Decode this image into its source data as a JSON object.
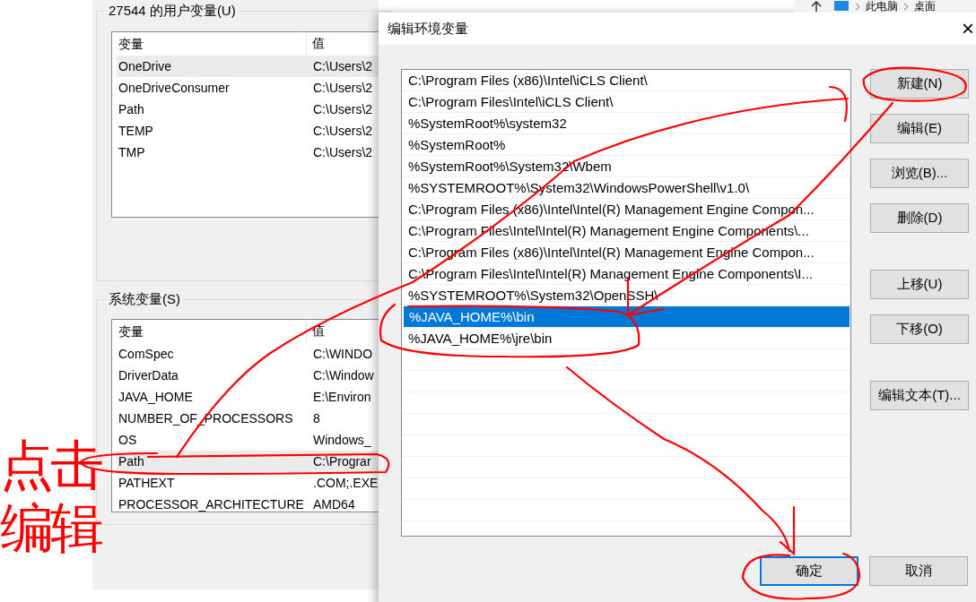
{
  "explorer_breadcrumb": [
    "此电脑",
    "桌面"
  ],
  "env_window": {
    "user_group": {
      "title": "27544 的用户变量(U)",
      "columns": [
        "变量",
        "值"
      ],
      "rows": [
        {
          "name": "OneDrive",
          "value": "C:\\Users\\2",
          "selected": true
        },
        {
          "name": "OneDriveConsumer",
          "value": "C:\\Users\\2",
          "selected": false
        },
        {
          "name": "Path",
          "value": "C:\\Users\\2",
          "selected": false
        },
        {
          "name": "TEMP",
          "value": "C:\\Users\\2",
          "selected": false
        },
        {
          "name": "TMP",
          "value": "C:\\Users\\2",
          "selected": false
        }
      ]
    },
    "system_group": {
      "title": "系统变量(S)",
      "columns": [
        "变量",
        "值"
      ],
      "rows": [
        {
          "name": "ComSpec",
          "value": "C:\\WINDO",
          "selected": false
        },
        {
          "name": "DriverData",
          "value": "C:\\Window",
          "selected": false
        },
        {
          "name": "JAVA_HOME",
          "value": "E:\\Environ",
          "selected": false
        },
        {
          "name": "NUMBER_OF_PROCESSORS",
          "value": "8",
          "selected": false
        },
        {
          "name": "OS",
          "value": "Windows_",
          "selected": false
        },
        {
          "name": "Path",
          "value": "C:\\Prograr",
          "selected": true
        },
        {
          "name": "PATHEXT",
          "value": ".COM;.EXE",
          "selected": false
        },
        {
          "name": "PROCESSOR_ARCHITECTURE",
          "value": "AMD64",
          "selected": false
        }
      ]
    }
  },
  "dialog": {
    "title": "编辑环境变量",
    "close": "×",
    "entries": [
      {
        "text": "C:\\Program Files (x86)\\Intel\\iCLS Client\\",
        "selected": false
      },
      {
        "text": "C:\\Program Files\\Intel\\iCLS Client\\",
        "selected": false
      },
      {
        "text": "%SystemRoot%\\system32",
        "selected": false
      },
      {
        "text": "%SystemRoot%",
        "selected": false
      },
      {
        "text": "%SystemRoot%\\System32\\Wbem",
        "selected": false
      },
      {
        "text": "%SYSTEMROOT%\\System32\\WindowsPowerShell\\v1.0\\",
        "selected": false
      },
      {
        "text": "C:\\Program Files (x86)\\Intel\\Intel(R) Management Engine Compon...",
        "selected": false
      },
      {
        "text": "C:\\Program Files\\Intel\\Intel(R) Management Engine Components\\...",
        "selected": false
      },
      {
        "text": "C:\\Program Files (x86)\\Intel\\Intel(R) Management Engine Compon...",
        "selected": false
      },
      {
        "text": "C:\\Program Files\\Intel\\Intel(R) Management Engine Components\\I...",
        "selected": false
      },
      {
        "text": "%SYSTEMROOT%\\System32\\OpenSSH\\",
        "selected": false
      },
      {
        "text": "%JAVA_HOME%\\bin",
        "selected": true
      },
      {
        "text": "%JAVA_HOME%\\jre\\bin",
        "selected": false
      }
    ],
    "side_button_groups": [
      [
        "新建(N)",
        "编辑(E)",
        "浏览(B)...",
        "删除(D)"
      ],
      [
        "上移(U)",
        "下移(O)"
      ],
      [
        "编辑文本(T)..."
      ]
    ],
    "footer_buttons": [
      {
        "label": "确定",
        "default": true
      },
      {
        "label": "取消",
        "default": false
      }
    ]
  },
  "annotation": {
    "lines": [
      "点击",
      "编辑"
    ]
  }
}
